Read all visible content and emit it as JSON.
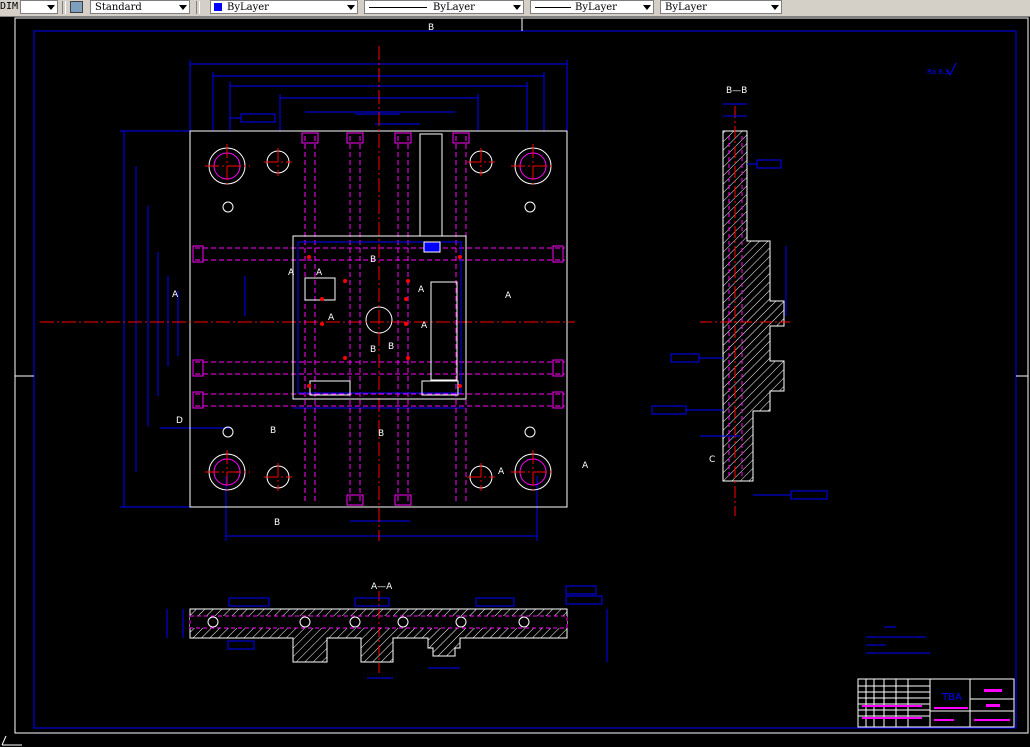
{
  "toolbar": {
    "dim_style_prefix": "DIM",
    "text_style": "Standard",
    "color": "ByLayer",
    "linetype": "ByLayer",
    "lineweight": "ByLayer",
    "plot_style": "ByLayer"
  },
  "drawing": {
    "view_labels": {
      "section_bb": "B—B",
      "section_aa": "A—A"
    },
    "section_markers": {
      "a": "A",
      "b": "B",
      "c": "C",
      "d": "D"
    },
    "roughness_note": "Ra 6.3",
    "title_block": {
      "part_code": "TBA"
    }
  },
  "colors": {
    "background": "#000000",
    "outline": "#ffffff",
    "dimension": "#0000ff",
    "centerline": "#ff0000",
    "hidden": "#ff00ff",
    "hatch": "#ffffff",
    "toolbar": "#d4d0c8"
  }
}
